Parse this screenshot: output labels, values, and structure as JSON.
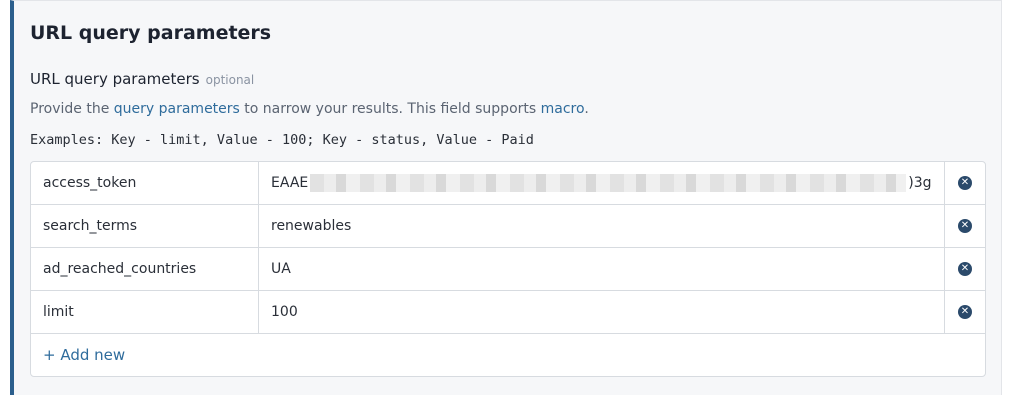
{
  "section": {
    "title": "URL query parameters",
    "field_label": "URL query parameters",
    "optional_tag": "optional",
    "help": {
      "prefix": "Provide the ",
      "link1": "query parameters",
      "middle": " to narrow your results. This field supports ",
      "link2": "macro",
      "suffix": "."
    },
    "examples": "Examples: Key - limit, Value - 100; Key - status, Value - Paid"
  },
  "params": [
    {
      "key": "access_token",
      "value_start": "EAAE",
      "value_end": ")3g"
    },
    {
      "key": "search_terms",
      "value": "renewables"
    },
    {
      "key": "ad_reached_countries",
      "value": "UA"
    },
    {
      "key": "limit",
      "value": "100"
    }
  ],
  "add_new_label": "+ Add new",
  "icons": {
    "delete": "close-circle-icon"
  }
}
